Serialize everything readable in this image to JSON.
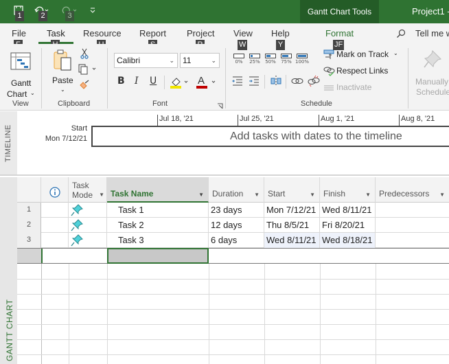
{
  "titlebar": {
    "qat": [
      {
        "icon": "save-icon",
        "keytip": "1"
      },
      {
        "icon": "undo-icon",
        "keytip": "2"
      },
      {
        "icon": "redo-icon",
        "keytip": "3"
      },
      {
        "icon": "customize-qat-icon"
      }
    ],
    "contextual_tab": "Gantt Chart Tools",
    "app_title": "Project1  -"
  },
  "tabs": [
    {
      "label": "File",
      "keytip": "F"
    },
    {
      "label": "Task",
      "keytip": "H",
      "active": true
    },
    {
      "label": "Resource",
      "keytip": "U"
    },
    {
      "label": "Report",
      "keytip": "S"
    },
    {
      "label": "Project",
      "keytip": "R"
    },
    {
      "label": "View",
      "keytip": "W"
    },
    {
      "label": "Help",
      "keytip": "Y"
    },
    {
      "label": "Format",
      "keytip": "JF"
    }
  ],
  "tell_me": "Tell me w",
  "ribbon": {
    "view": {
      "gantt_chart": "Gantt",
      "gantt_chart2": "Chart",
      "label": "View"
    },
    "clipboard": {
      "paste": "Paste",
      "label": "Clipboard"
    },
    "font": {
      "family": "Calibri",
      "size": "11",
      "bold": "B",
      "italic": "I",
      "underline": "U",
      "label": "Font",
      "highlight_color": "#f2e600",
      "font_color": "#c00000"
    },
    "schedule": {
      "percent_complete": [
        {
          "label": "0%",
          "fill": 0
        },
        {
          "label": "25%",
          "fill": 0.25
        },
        {
          "label": "50%",
          "fill": 0.5
        },
        {
          "label": "75%",
          "fill": 0.75
        },
        {
          "label": "100%",
          "fill": 1
        }
      ],
      "mark_on_track": "Mark on Track",
      "respect_links": "Respect Links",
      "inactivate": "Inactivate",
      "label": "Schedule"
    },
    "tasks": {
      "manually": "Manually",
      "schedule": "Schedule"
    }
  },
  "timeline": {
    "side_label": "TIMELINE",
    "start_label": "Start",
    "start_date": "Mon 7/12/21",
    "placeholder": "Add tasks with dates to the timeline",
    "ticks": [
      "Jul 18, '21",
      "Jul 25, '21",
      "Aug 1, '21",
      "Aug 8, '21"
    ]
  },
  "gantt": {
    "side_label": "GANTT CHART",
    "columns": {
      "indicators": "i",
      "task_mode": [
        "Task",
        "Mode"
      ],
      "task_name": "Task Name",
      "duration": "Duration",
      "start": "Start",
      "finish": "Finish",
      "predecessors": "Predecessors"
    },
    "rows": [
      {
        "id": "1",
        "name": "Task 1",
        "duration": "23 days",
        "start": "Mon 7/12/21",
        "finish": "Wed 8/11/21",
        "predecessors": ""
      },
      {
        "id": "2",
        "name": "Task 2",
        "duration": "12 days",
        "start": "Thu 8/5/21",
        "finish": "Fri 8/20/21",
        "predecessors": ""
      },
      {
        "id": "3",
        "name": "Task 3",
        "duration": "6 days",
        "start": "Wed 8/11/21",
        "finish": "Wed 8/18/21",
        "predecessors": ""
      }
    ]
  },
  "colors": {
    "brand": "#2f7332",
    "brand_dark": "#245c27"
  }
}
